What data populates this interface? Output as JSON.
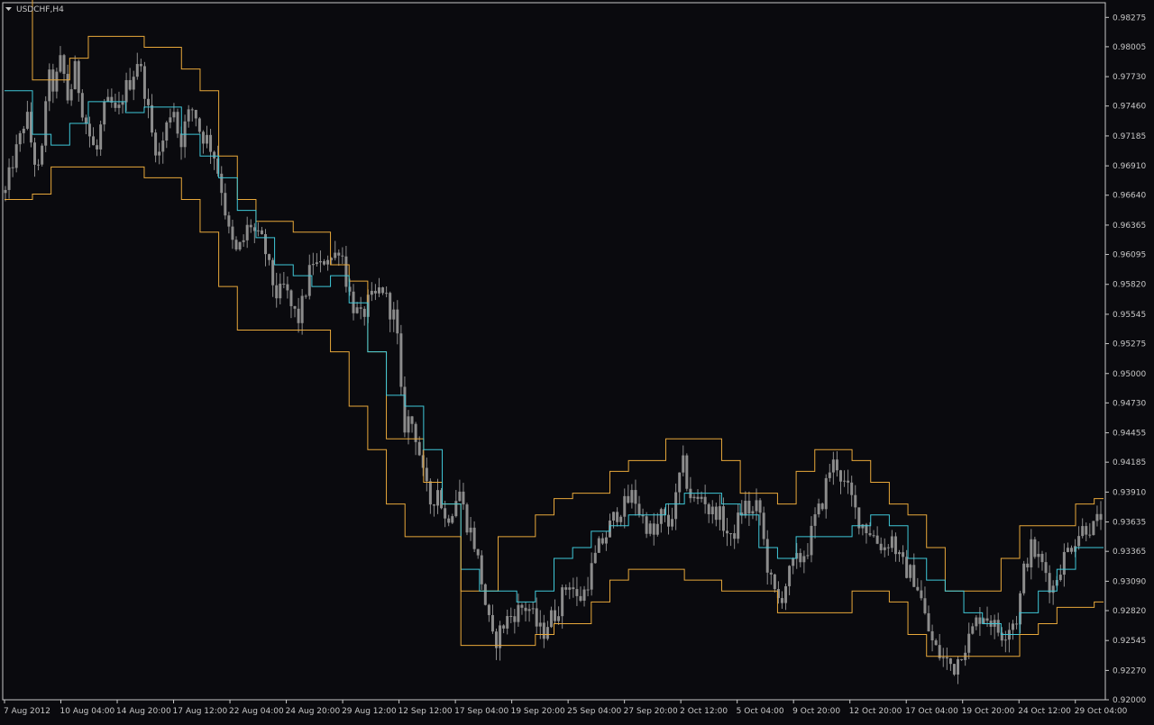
{
  "window": {
    "title": "USDCHF,H4",
    "menu_icon": "triangle-down-icon"
  },
  "colors": {
    "background": "#0a0a0e",
    "frame": "#c8c8c8",
    "text": "#c8c8c8",
    "candle": "#8c8c8c",
    "channel_bands": "#e8a83a",
    "channel_middle": "#3fc8d8"
  },
  "chart_data": {
    "type": "candlestick",
    "symbol": "USDCHF",
    "timeframe": "H4",
    "title": "USDCHF,H4",
    "ylim": [
      0.92,
      0.9841
    ],
    "y_ticks": [
      "0.98275",
      "0.98005",
      "0.97730",
      "0.97460",
      "0.97185",
      "0.96910",
      "0.96640",
      "0.96365",
      "0.96095",
      "0.95820",
      "0.95545",
      "0.95275",
      "0.95000",
      "0.94730",
      "0.94455",
      "0.94185",
      "0.93910",
      "0.93635",
      "0.93365",
      "0.93090",
      "0.92820",
      "0.92545",
      "0.92270",
      "0.92000"
    ],
    "x_ticks": [
      "7 Aug 2012",
      "10 Aug 04:00",
      "14 Aug 20:00",
      "17 Aug 12:00",
      "22 Aug 04:00",
      "24 Aug 20:00",
      "29 Aug 12:00",
      "12 Sep 12:00",
      "17 Sep 04:00",
      "19 Sep 20:00",
      "25 Sep 04:00",
      "27 Sep 20:00",
      "2 Oct 12:00",
      "5 Oct 04:00",
      "9 Oct 20:00",
      "12 Oct 20:00",
      "17 Oct 04:00",
      "19 Oct 20:00",
      "24 Oct 12:00",
      "29 Oct 04:00"
    ],
    "close_path": [
      0.9666,
      0.9694,
      0.9713,
      0.974,
      0.97,
      0.968,
      0.9775,
      0.9762,
      0.979,
      0.975,
      0.978,
      0.9745,
      0.972,
      0.97,
      0.974,
      0.975,
      0.9735,
      0.976,
      0.977,
      0.979,
      0.976,
      0.972,
      0.97,
      0.9725,
      0.975,
      0.971,
      0.9735,
      0.9745,
      0.972,
      0.9715,
      0.97,
      0.967,
      0.963,
      0.961,
      0.962,
      0.964,
      0.9625,
      0.962,
      0.959,
      0.957,
      0.958,
      0.956,
      0.955,
      0.9575,
      0.9605,
      0.9595,
      0.961,
      0.9605,
      0.962,
      0.958,
      0.956,
      0.955,
      0.9565,
      0.957,
      0.958,
      0.956,
      0.955,
      0.945,
      0.946,
      0.944,
      0.94,
      0.938,
      0.9395,
      0.9365,
      0.9375,
      0.9395,
      0.9365,
      0.935,
      0.932,
      0.928,
      0.925,
      0.9265,
      0.9275,
      0.928,
      0.9285,
      0.9285,
      0.927,
      0.926,
      0.9275,
      0.928,
      0.93,
      0.931,
      0.929,
      0.93,
      0.932,
      0.934,
      0.935,
      0.9365,
      0.9375,
      0.938,
      0.939,
      0.937,
      0.936,
      0.935,
      0.937,
      0.936,
      0.938,
      0.942,
      0.939,
      0.938,
      0.939,
      0.937,
      0.9375,
      0.936,
      0.9345,
      0.9365,
      0.938,
      0.937,
      0.938,
      0.933,
      0.93,
      0.929,
      0.931,
      0.9325,
      0.933,
      0.934,
      0.9365,
      0.938,
      0.941,
      0.942,
      0.94,
      0.939,
      0.937,
      0.936,
      0.9355,
      0.9345,
      0.934,
      0.935,
      0.933,
      0.932,
      0.9315,
      0.93,
      0.927,
      0.925,
      0.924,
      0.9235,
      0.923,
      0.9245,
      0.9255,
      0.927,
      0.928,
      0.9275,
      0.9265,
      0.926,
      0.927,
      0.9275,
      0.932,
      0.934,
      0.933,
      0.932,
      0.93,
      0.932,
      0.9335,
      0.9345,
      0.9355,
      0.936,
      0.9358,
      0.937
    ],
    "series": [
      {
        "name": "upper",
        "values": [
          0.9855,
          0.9855,
          0.977,
          0.977,
          0.979,
          0.981,
          0.981,
          0.981,
          0.98,
          0.98,
          0.978,
          0.976,
          0.97,
          0.966,
          0.964,
          0.964,
          0.963,
          0.963,
          0.96,
          0.9585,
          0.952,
          0.944,
          0.944,
          0.94,
          0.938,
          0.93,
          0.93,
          0.935,
          0.935,
          0.937,
          0.9385,
          0.939,
          0.939,
          0.941,
          0.942,
          0.942,
          0.944,
          0.944,
          0.944,
          0.942,
          0.939,
          0.939,
          0.938,
          0.941,
          0.943,
          0.943,
          0.942,
          0.94,
          0.938,
          0.937,
          0.934,
          0.93,
          0.93,
          0.93,
          0.933,
          0.936,
          0.936,
          0.936,
          0.938,
          0.9385
        ]
      },
      {
        "name": "middle",
        "values": [
          0.976,
          0.976,
          0.972,
          0.971,
          0.973,
          0.975,
          0.975,
          0.974,
          0.9745,
          0.9745,
          0.972,
          0.97,
          0.968,
          0.965,
          0.9625,
          0.96,
          0.959,
          0.958,
          0.959,
          0.9565,
          0.952,
          0.948,
          0.947,
          0.943,
          0.938,
          0.932,
          0.93,
          0.93,
          0.929,
          0.93,
          0.933,
          0.934,
          0.9355,
          0.936,
          0.937,
          0.937,
          0.938,
          0.939,
          0.939,
          0.938,
          0.937,
          0.934,
          0.933,
          0.935,
          0.935,
          0.935,
          0.936,
          0.937,
          0.936,
          0.933,
          0.931,
          0.93,
          0.928,
          0.927,
          0.926,
          0.928,
          0.93,
          0.932,
          0.934,
          0.934
        ]
      },
      {
        "name": "lower",
        "values": [
          0.966,
          0.966,
          0.9665,
          0.969,
          0.969,
          0.969,
          0.969,
          0.969,
          0.968,
          0.968,
          0.966,
          0.963,
          0.958,
          0.954,
          0.954,
          0.954,
          0.954,
          0.954,
          0.952,
          0.947,
          0.943,
          0.938,
          0.935,
          0.935,
          0.935,
          0.925,
          0.925,
          0.925,
          0.925,
          0.926,
          0.927,
          0.927,
          0.929,
          0.931,
          0.932,
          0.932,
          0.932,
          0.931,
          0.931,
          0.93,
          0.93,
          0.93,
          0.928,
          0.928,
          0.928,
          0.928,
          0.93,
          0.93,
          0.929,
          0.926,
          0.924,
          0.924,
          0.924,
          0.924,
          0.924,
          0.926,
          0.927,
          0.9285,
          0.9285,
          0.929
        ]
      }
    ]
  }
}
